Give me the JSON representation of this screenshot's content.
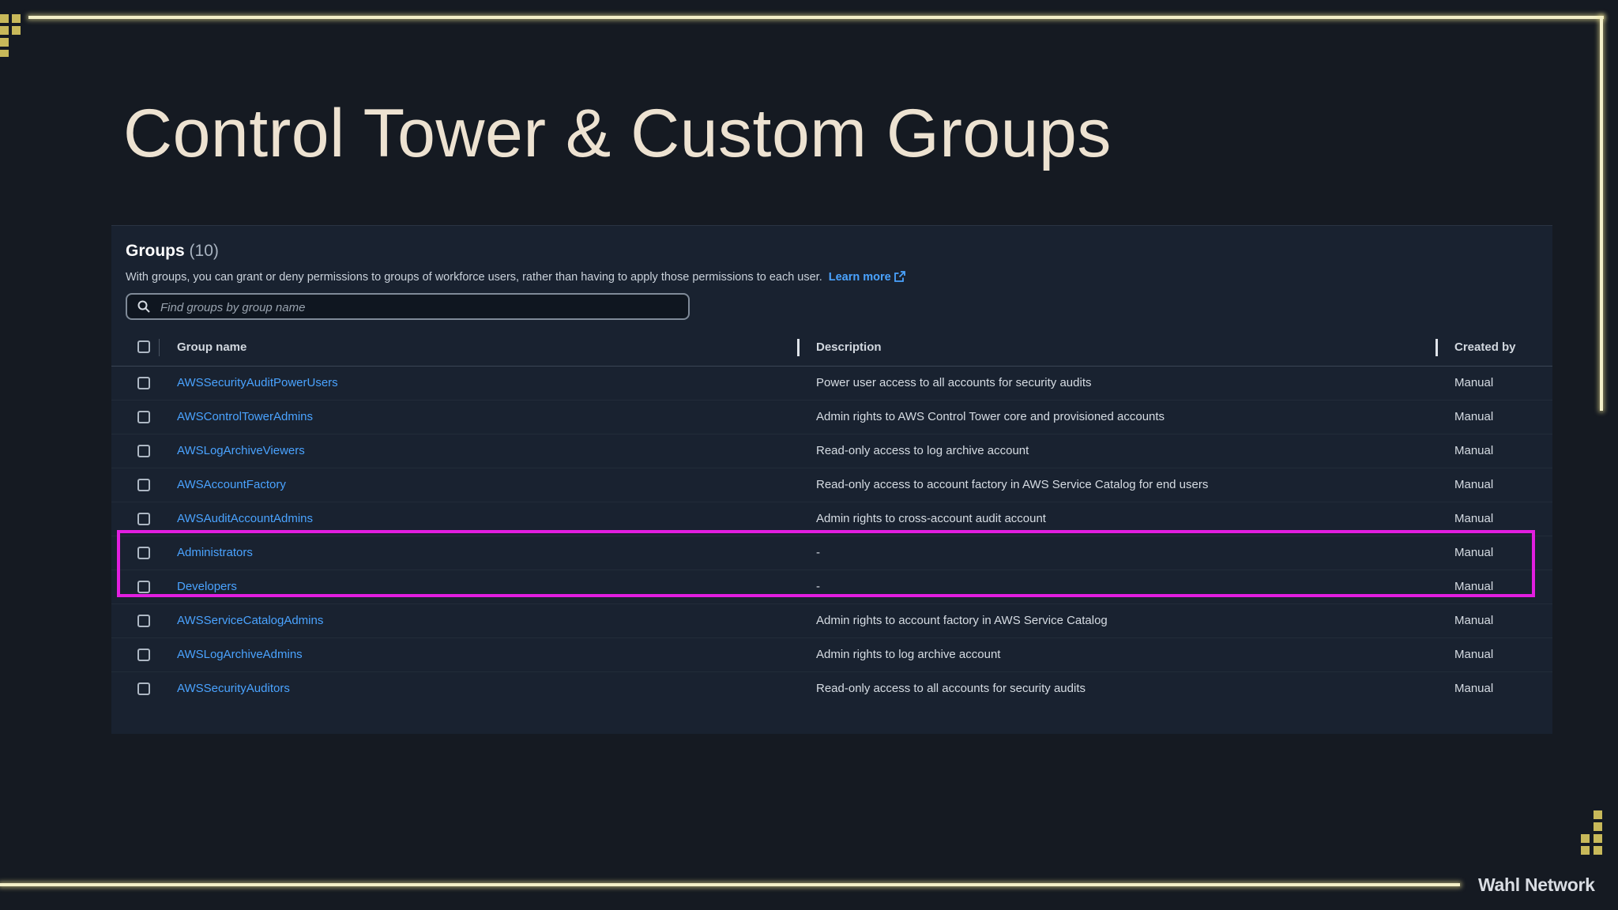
{
  "slide": {
    "title": "Control Tower & Custom Groups",
    "brand": "Wahl Network"
  },
  "panel": {
    "heading": "Groups",
    "count": "(10)",
    "description": "With groups, you can grant or deny permissions to groups of workforce users, rather than having to apply those permissions to each user.",
    "learn_more": "Learn more",
    "search_placeholder": "Find groups by group name"
  },
  "table": {
    "columns": [
      "Group name",
      "Description",
      "Created by"
    ],
    "rows": [
      {
        "name": "AWSSecurityAuditPowerUsers",
        "description": "Power user access to all accounts for security audits",
        "created_by": "Manual"
      },
      {
        "name": "AWSControlTowerAdmins",
        "description": "Admin rights to AWS Control Tower core and provisioned accounts",
        "created_by": "Manual"
      },
      {
        "name": "AWSLogArchiveViewers",
        "description": "Read-only access to log archive account",
        "created_by": "Manual"
      },
      {
        "name": "AWSAccountFactory",
        "description": "Read-only access to account factory in AWS Service Catalog for end users",
        "created_by": "Manual"
      },
      {
        "name": "AWSAuditAccountAdmins",
        "description": "Admin rights to cross-account audit account",
        "created_by": "Manual"
      },
      {
        "name": "Administrators",
        "description": "-",
        "created_by": "Manual"
      },
      {
        "name": "Developers",
        "description": "-",
        "created_by": "Manual"
      },
      {
        "name": "AWSServiceCatalogAdmins",
        "description": "Admin rights to account factory in AWS Service Catalog",
        "created_by": "Manual"
      },
      {
        "name": "AWSLogArchiveAdmins",
        "description": "Admin rights to log archive account",
        "created_by": "Manual"
      },
      {
        "name": "AWSSecurityAuditors",
        "description": "Read-only access to all accounts for security audits",
        "created_by": "Manual"
      }
    ]
  },
  "colors": {
    "background": "#151a22",
    "panel": "#192230",
    "link": "#4aa3ff",
    "highlight": "#e21ee0",
    "frame_glow": "#f3efc8",
    "accent_squares": "#c8b95a"
  }
}
